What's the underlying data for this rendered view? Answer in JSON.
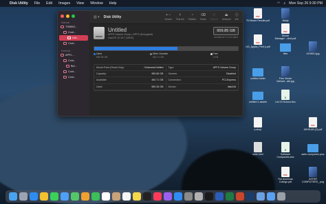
{
  "menubar": {
    "app": "Disk Utility",
    "items": [
      "File",
      "Edit",
      "Images",
      "View",
      "Window",
      "Help"
    ],
    "clock": "Mon Sep 26  9:30 PM"
  },
  "window": {
    "title": "Disk Utility",
    "view_label": "View",
    "toolbar": [
      "Volume",
      "First Aid",
      "Partition",
      "Erase",
      "Restore",
      "Unmount",
      "Info"
    ],
    "sidebar": {
      "internal_label": "Internal",
      "external_label": "External",
      "items": [
        "TS960G...",
        "Cont...",
        "Unt...",
        "Cont...",
        "APPL...",
        "Cont...",
        "Bel...",
        "Cont...",
        "Cont..."
      ]
    },
    "volume": {
      "name": "Untitled",
      "subtitle": "APFS Volume Group • APFS (Encrypted)",
      "os": "macOS 10.15.7 (19H2)",
      "size": "959.85 GB",
      "size_caption": "SHARED BY 5 VOLUMES"
    },
    "usage": {
      "used_label": "Used",
      "used_value": "559.35 GB",
      "used_fraction": 0.58,
      "other_label": "Other Volumes",
      "other_value": "400.71 GB",
      "other_fraction": 0.42,
      "free_label": "Free",
      "free_value": "0 KB",
      "colors": {
        "used": "#2e7de0",
        "other": "#4a4a4a",
        "free": "#d8d8d8"
      }
    },
    "info": [
      [
        "Mount Point (Read-Only):",
        "/Volumes/Untitled"
      ],
      [
        "Type:",
        "APFS Volume Group"
      ],
      [
        "Capacity:",
        "959.85 GB"
      ],
      [
        "Owners:",
        "Disabled"
      ],
      [
        "Available:",
        "400.71 GB"
      ],
      [
        "Connection:",
        "PCI-Express"
      ],
      [
        "Used:",
        "559.35 GB"
      ],
      [
        "Device:",
        "disk2s5"
      ]
    ]
  },
  "desktop": [
    "Balaji",
    "TN Board Results.pdf",
    "Ebook Manager....shot.pdf",
    "UG_Applic_Print p.pdf",
    "files",
    "ACMDU.jpg",
    "untitled folder",
    "Free Vector interset...ath.jpg",
    "untitled 1-assets",
    "List Of School.xlsx",
    "p.shop",
    "AKHILAN (2).pdf",
    "write.html",
    "Software Companies.xlsx",
    "aster computers pics",
    "The American College.pdf",
    "ASTER COMPUTERS_.png"
  ],
  "dock": [
    "Finder",
    "Launchpad",
    "Safari",
    "Chrome",
    "Messages",
    "Mail",
    "Maps",
    "Photos",
    "FaceTime",
    "Calendar",
    "Contacts",
    "Reminders",
    "Notes",
    "TV",
    "Music",
    "Podcasts",
    "App Store",
    "System Preferences",
    "Disk Utility",
    "Terminal",
    "Word",
    "Excel",
    "PowerPoint",
    "Photoshop",
    "Preview",
    "Downloads",
    "Trash"
  ]
}
